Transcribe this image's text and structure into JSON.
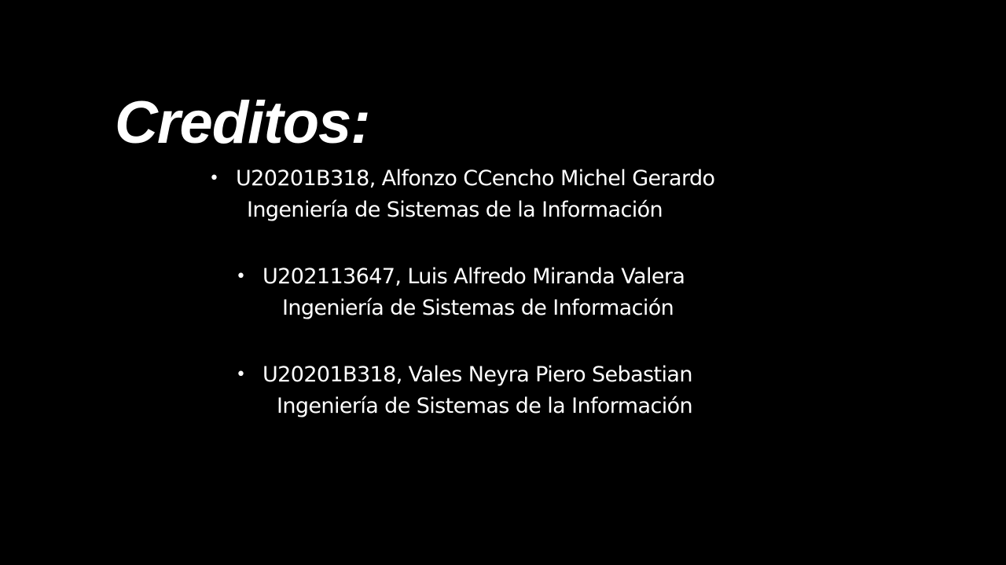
{
  "slide": {
    "title": "Creditos:",
    "background_color": "#000000",
    "text_color": "#ffffff",
    "credits": [
      {
        "bullet": "•",
        "student": "U20201B318, Alfonzo CCencho Michel Gerardo",
        "career": "Ingeniería de Sistemas de la Información"
      },
      {
        "bullet": "•",
        "student": "U202113647, Luis Alfredo Miranda Valera",
        "career": "Ingeniería de Sistemas de Información"
      },
      {
        "bullet": "•",
        "student": "U20201B318, Vales Neyra Piero Sebastian",
        "career": "Ingeniería de Sistemas de la Información"
      }
    ]
  }
}
